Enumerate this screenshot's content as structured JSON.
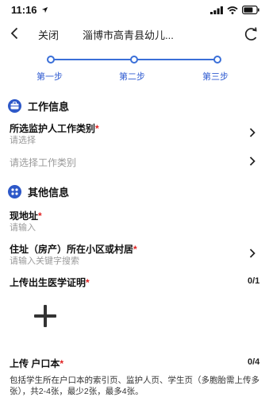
{
  "status_bar": {
    "time": "11:16"
  },
  "nav": {
    "close_label": "关闭",
    "title": "淄博市高青县幼儿..."
  },
  "steps": [
    {
      "label": "第一步"
    },
    {
      "label": "第二步"
    },
    {
      "label": "第三步"
    }
  ],
  "work_section": {
    "title": "工作信息",
    "guardian_type": {
      "label": "所选监护人工作类别",
      "required_mark": "*",
      "placeholder": "请选择"
    },
    "work_type": {
      "placeholder": "请选择工作类别"
    }
  },
  "other_section": {
    "title": "其他信息",
    "address": {
      "label": "现地址",
      "required_mark": "*",
      "placeholder": "请输入"
    },
    "residence": {
      "label": "住址（房产）所在小区或村居",
      "required_mark": "*",
      "placeholder": "请输入关键字搜索"
    },
    "birth_cert": {
      "label": "上传出生医学证明",
      "required_mark": "*",
      "count": "0/1"
    },
    "hukou": {
      "label": "上传 户口本",
      "required_mark": "*",
      "count": "0/4"
    },
    "hukou_note": "包括学生所在户口本的索引页、监护人页、学生页（多胞胎需上传多张），共2-4张，最少2张，最多4张。"
  },
  "colors": {
    "accent": "#2d58c8",
    "required": "#e02020",
    "placeholder": "#9a9a9a"
  },
  "icons": [
    "location-arrow-icon",
    "signal-icon",
    "wifi-icon",
    "battery-icon",
    "back-chevron-icon",
    "refresh-icon",
    "briefcase-icon",
    "info-icon",
    "chevron-right-icon",
    "plus-icon"
  ]
}
